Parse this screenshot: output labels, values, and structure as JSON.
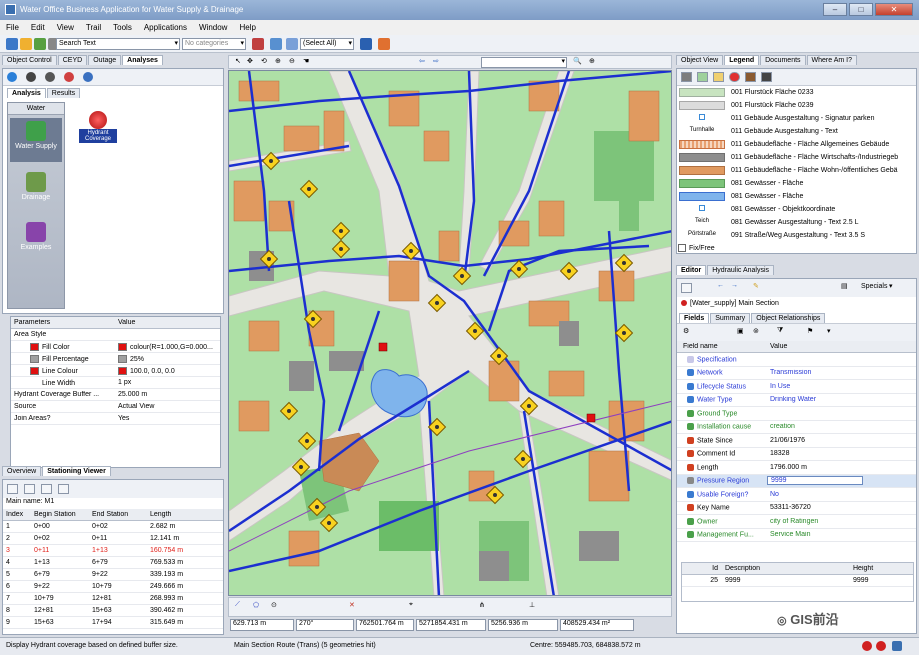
{
  "window": {
    "title": "Water Office Business Application for Water Supply & Drainage"
  },
  "menu": [
    "File",
    "Edit",
    "View",
    "Trail",
    "Tools",
    "Applications",
    "Window",
    "Help"
  ],
  "toolbar": {
    "search_value": "Search Text",
    "category_placeholder": "No categories",
    "select_value": "(Select All)"
  },
  "left_tabs": [
    "Object Control",
    "CEYD",
    "Outage",
    "Analyses"
  ],
  "analysis_subtabs": [
    "Analysis",
    "Results"
  ],
  "water_header": "Water",
  "categories": [
    "Water Supply",
    "Drainage",
    "Examples"
  ],
  "hydrant_tool": "Hydrant Coverage",
  "params": {
    "headers": [
      "Parameters",
      "Value"
    ],
    "rows": [
      {
        "name": "Area Style",
        "value": "",
        "indent": 0
      },
      {
        "name": "Fill Color",
        "value": "colour(R=1.000,G=0.000...",
        "indent": 1,
        "swatch": "#e01010"
      },
      {
        "name": "Fill Percentage",
        "value": "25%",
        "indent": 1,
        "swatch": "#a0a0a0"
      },
      {
        "name": "Line Colour",
        "value": "100.0, 0.0, 0.0",
        "indent": 1,
        "swatch": "#e01010"
      },
      {
        "name": "Line Width",
        "value": "1 px",
        "indent": 1,
        "swatch": ""
      },
      {
        "name": "Hydrant Coverage Buffer ...",
        "value": "25.000 m",
        "indent": 0
      },
      {
        "name": "Source",
        "value": "Actual View",
        "indent": 0
      },
      {
        "name": "Join Areas?",
        "value": "Yes",
        "indent": 0
      }
    ]
  },
  "bottom_tabs": [
    "Overview",
    "Stationing Viewer"
  ],
  "main_name": "Main name: M1",
  "stations": {
    "headers": [
      "Index",
      "Begin Station",
      "End Station",
      "Length"
    ],
    "rows": [
      [
        "1",
        "0+00",
        "0+02",
        "2.682 m"
      ],
      [
        "2",
        "0+02",
        "0+11",
        "12.141 m"
      ],
      [
        "3",
        "0+11",
        "1+13",
        "160.754 m"
      ],
      [
        "4",
        "1+13",
        "6+79",
        "769.533 m"
      ],
      [
        "5",
        "6+79",
        "9+22",
        "339.193 m"
      ],
      [
        "6",
        "9+22",
        "10+79",
        "249.666 m"
      ],
      [
        "7",
        "10+79",
        "12+81",
        "268.993 m"
      ],
      [
        "8",
        "12+81",
        "15+63",
        "390.462 m"
      ],
      [
        "9",
        "15+63",
        "17+94",
        "315.649 m"
      ]
    ],
    "highlight_index": 2
  },
  "coords": [
    "629.713 m",
    "270°",
    "762501.764 m",
    "5271854.431 m",
    "5256.936 m",
    "408529.434 m²"
  ],
  "right_tabs": [
    "Object View",
    "Legend",
    "Documents",
    "Where Am I?"
  ],
  "legend": [
    {
      "icon": "fill",
      "color": "#c8e4c0",
      "border": "#a0b0a0",
      "text": "001 Flurstück Fläche 0233"
    },
    {
      "icon": "fill",
      "color": "#dcdcdc",
      "border": "#a8a8a8",
      "text": "001 Flurstück Fläche 0239"
    },
    {
      "icon": "square",
      "color": "#ffffff",
      "border": "#3a8ad6",
      "text": "011 Gebäude Ausgestaltung - Signatur parken"
    },
    {
      "icon": "text",
      "label": "Turnhalle",
      "text": "011 Gebäude Ausgestaltung - Text"
    },
    {
      "icon": "hatch",
      "color": "#e8a070",
      "border": "#c87040",
      "text": "011 Gebäudefläche - Fläche Allgemeines Gebäude"
    },
    {
      "icon": "fill",
      "color": "#8e8e8e",
      "border": "#707070",
      "text": "011 Gebäudefläche - Fläche Wirtschafts-/Industriegeb"
    },
    {
      "icon": "fill",
      "color": "#e09a60",
      "border": "#b07040",
      "text": "011 Gebäudefläche - Fläche Wohn-/öffentliches Gebä"
    },
    {
      "icon": "fill",
      "color": "#7dc47a",
      "border": "#5a9a58",
      "text": "081 Gewässer - Fläche"
    },
    {
      "icon": "fill",
      "color": "#7fb4ec",
      "border": "#3a6fd0",
      "text": "081 Gewässer - Fläche"
    },
    {
      "icon": "square",
      "color": "#ffffff",
      "border": "#3a8ad6",
      "text": "081 Gewässer - Objektkoordinate"
    },
    {
      "icon": "text",
      "label": "Teich",
      "text": "081 Gewässer Ausgestaltung - Text 2.5 L"
    },
    {
      "icon": "text",
      "label": "Pörtstraße",
      "text": "091 Straße/Weg Ausgestaltung - Text 3.5 S"
    }
  ],
  "fixfree": "Fix/Free",
  "editor_tabs": [
    "Editor",
    "Hydraulic Analysis"
  ],
  "specials": "Specials",
  "section_label": "[Water_supply] Main Section",
  "field_tabs": [
    "Fields",
    "Summary",
    "Object Relationships"
  ],
  "fields": {
    "headers": [
      "Field name",
      "Value"
    ],
    "rows": [
      {
        "name": "Specification",
        "value": "",
        "color": "blue",
        "icon": "#c8c8e8"
      },
      {
        "name": "Network",
        "value": "Transmission",
        "color": "blue",
        "icon": "#3a7ad0"
      },
      {
        "name": "Lifecycle Status",
        "value": "In Use",
        "color": "blue",
        "icon": "#3a7ad0"
      },
      {
        "name": "Water Type",
        "value": "Drinking Water",
        "color": "blue",
        "icon": "#3a7ad0"
      },
      {
        "name": "Ground Type",
        "value": "",
        "color": "green",
        "icon": "#4aa04a"
      },
      {
        "name": "Installation cause",
        "value": "creation",
        "color": "green",
        "icon": "#4aa04a"
      },
      {
        "name": "State Since",
        "value": "21/06/1976",
        "color": "black",
        "icon": "#d04020"
      },
      {
        "name": "Comment Id",
        "value": "18328",
        "color": "black",
        "icon": "#d04020"
      },
      {
        "name": "Length",
        "value": "1796.000 m",
        "color": "black",
        "icon": "#d04020"
      },
      {
        "name": "Pressure Region",
        "value": "9999",
        "color": "blue",
        "icon": "#888888"
      },
      {
        "name": "Usable Foreign?",
        "value": "No",
        "color": "blue",
        "icon": "#3a7ad0"
      },
      {
        "name": "Key Name",
        "value": "53311-36720",
        "color": "black",
        "icon": "#d04020"
      },
      {
        "name": "Owner",
        "value": "city of Ratingen",
        "color": "green",
        "icon": "#4aa04a"
      },
      {
        "name": "Management Fu...",
        "value": "Service Main",
        "color": "green",
        "icon": "#4aa04a"
      }
    ]
  },
  "bottom_table": {
    "headers": [
      "Id",
      "Description",
      "Height"
    ],
    "row": [
      "25",
      "9999",
      "9999"
    ]
  },
  "watermark": "GIS前沿",
  "status": {
    "left": "Display Hydrant coverage based on defined buffer size.",
    "middle": "Main Section Route (Trans) (5 geometries hit)",
    "right": "Centre: 559485.703, 684838.572 m"
  }
}
